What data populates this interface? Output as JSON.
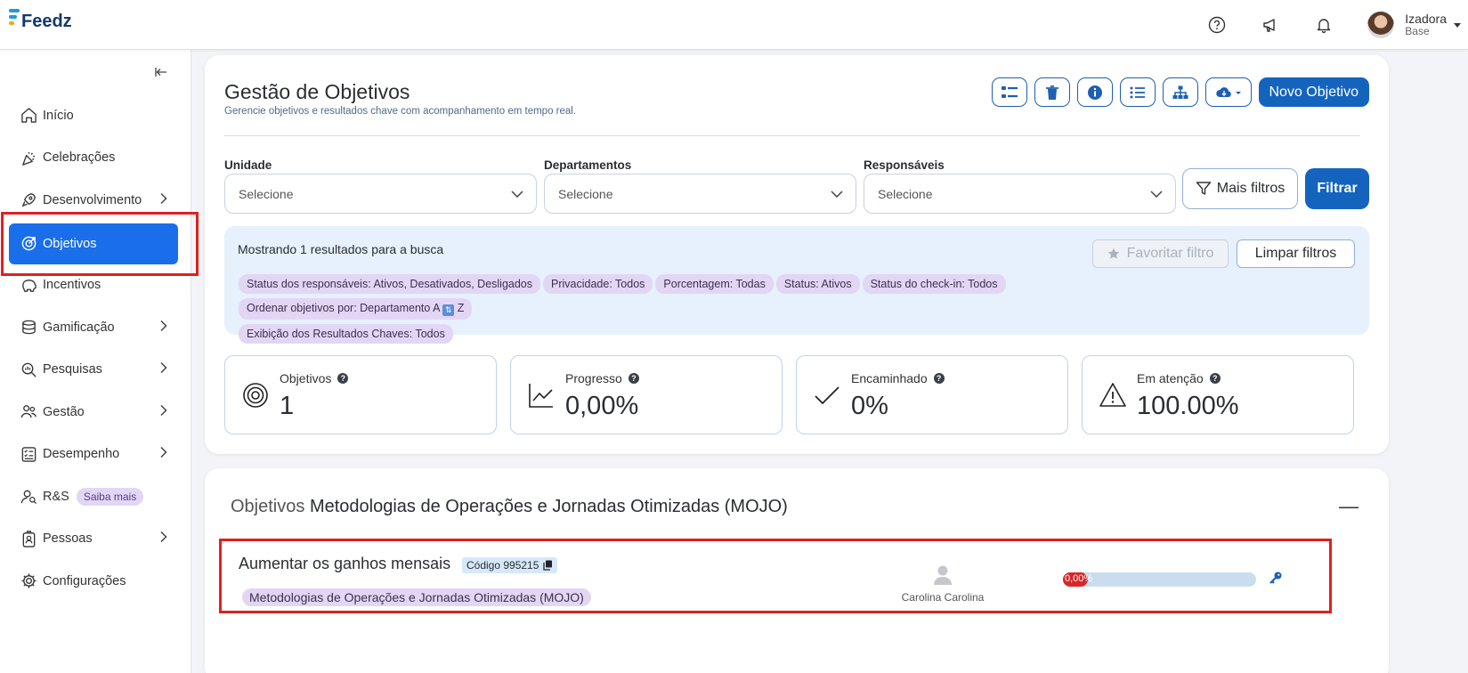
{
  "app": {
    "logo_text": "Feedz"
  },
  "user": {
    "name": "Izadora",
    "subtitle": "Base"
  },
  "sidebar": {
    "items": [
      {
        "label": "Início",
        "icon": "home-icon",
        "chevron": false
      },
      {
        "label": "Celebrações",
        "icon": "party-icon",
        "chevron": false
      },
      {
        "label": "Desenvolvimento",
        "icon": "rocket-icon",
        "chevron": true
      },
      {
        "label": "Objetivos",
        "icon": "target-icon",
        "chevron": false,
        "active": true
      },
      {
        "label": "Incentivos",
        "icon": "piggy-bank-icon",
        "chevron": false
      },
      {
        "label": "Gamificação",
        "icon": "coins-icon",
        "chevron": true
      },
      {
        "label": "Pesquisas",
        "icon": "search-chart-icon",
        "chevron": true
      },
      {
        "label": "Gestão",
        "icon": "people-icon",
        "chevron": true
      },
      {
        "label": "Desempenho",
        "icon": "checklist-icon",
        "chevron": true
      },
      {
        "label": "R&S",
        "icon": "person-search-icon",
        "chevron": false,
        "badge": "Saiba mais"
      },
      {
        "label": "Pessoas",
        "icon": "id-badge-icon",
        "chevron": true
      },
      {
        "label": "Configurações",
        "icon": "gear-icon",
        "chevron": false
      }
    ]
  },
  "header": {
    "title": "Gestão de Objetivos",
    "subtitle": "Gerencie objetivos e resultados chave com acompanhamento em tempo real.",
    "new_button": "Novo Objetivo"
  },
  "filters": {
    "unidade": {
      "label": "Unidade",
      "placeholder": "Selecione"
    },
    "departamentos": {
      "label": "Departamentos",
      "placeholder": "Selecione"
    },
    "responsaveis": {
      "label": "Responsáveis",
      "placeholder": "Selecione"
    },
    "more_filters": "Mais filtros",
    "apply": "Filtrar"
  },
  "results": {
    "text": "Mostrando 1 resultados para a busca",
    "favorite": "Favoritar filtro",
    "clear": "Limpar filtros",
    "chips": [
      "Status dos responsáveis: Ativos, Desativados, Desligados",
      "Privacidade: Todos",
      "Porcentagem: Todas",
      "Status: Ativos",
      "Status do check-in: Todos"
    ],
    "order_chip": {
      "prefix": "Ordenar objetivos por: Departamento A",
      "suffix": "Z"
    },
    "chips2": [
      "Exibição dos Resultados Chaves: Todos"
    ]
  },
  "stats": [
    {
      "label": "Objetivos",
      "value": "1",
      "icon": "target-icon"
    },
    {
      "label": "Progresso",
      "value": "0,00%",
      "icon": "line-chart-icon"
    },
    {
      "label": "Encaminhado",
      "value": "0%",
      "icon": "check-icon"
    },
    {
      "label": "Em atenção",
      "value": "100.00%",
      "icon": "warning-icon"
    }
  ],
  "section": {
    "prefix": "Objetivos",
    "name": "Metodologias de Operações e Jornadas Otimizadas (MOJO)",
    "objective": {
      "title": "Aumentar os ganhos mensais",
      "code": "Código 995215",
      "department": "Metodologias de Operações e Jornadas Otimizadas (MOJO)",
      "owner": "Carolina Carolina",
      "progress_label": "0,00%",
      "progress_value": 0.0
    }
  },
  "colors": {
    "primary": "#1464be",
    "active_nav": "#1a6ee9",
    "chip": "#e3d6f4",
    "highlight": "#e02020",
    "progress_fill": "#d8262a"
  }
}
